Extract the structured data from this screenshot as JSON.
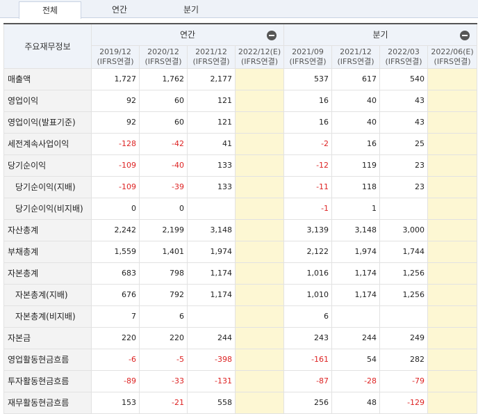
{
  "tabs": [
    "전체",
    "연간",
    "분기"
  ],
  "header": {
    "label": "주요재무정보",
    "group_annual": "연간",
    "group_quarter": "분기",
    "periods": [
      {
        "date": "2019/12",
        "basis": "(IFRS연결)"
      },
      {
        "date": "2020/12",
        "basis": "(IFRS연결)"
      },
      {
        "date": "2021/12",
        "basis": "(IFRS연결)"
      },
      {
        "date": "2022/12(E)",
        "basis": "(IFRS연결)"
      },
      {
        "date": "2021/09",
        "basis": "(IFRS연결)"
      },
      {
        "date": "2021/12",
        "basis": "(IFRS연결)"
      },
      {
        "date": "2022/03",
        "basis": "(IFRS연결)"
      },
      {
        "date": "2022/06(E)",
        "basis": "(IFRS연결)"
      }
    ]
  },
  "rows": [
    {
      "label": "매출액",
      "indent": false,
      "values": [
        "1,727",
        "1,762",
        "2,177",
        "",
        "537",
        "617",
        "540",
        ""
      ]
    },
    {
      "label": "영업이익",
      "indent": false,
      "values": [
        "92",
        "60",
        "121",
        "",
        "16",
        "40",
        "43",
        ""
      ]
    },
    {
      "label": "영업이익(발표기준)",
      "indent": false,
      "values": [
        "92",
        "60",
        "121",
        "",
        "16",
        "40",
        "43",
        ""
      ]
    },
    {
      "label": "세전계속사업이익",
      "indent": false,
      "values": [
        "-128",
        "-42",
        "41",
        "",
        "-2",
        "16",
        "25",
        ""
      ]
    },
    {
      "label": "당기순이익",
      "indent": false,
      "values": [
        "-109",
        "-40",
        "133",
        "",
        "-12",
        "119",
        "23",
        ""
      ]
    },
    {
      "label": "당기순이익(지배)",
      "indent": true,
      "values": [
        "-109",
        "-39",
        "133",
        "",
        "-11",
        "118",
        "23",
        ""
      ]
    },
    {
      "label": "당기순이익(비지배)",
      "indent": true,
      "values": [
        "0",
        "0",
        "",
        "",
        "-1",
        "1",
        "",
        ""
      ]
    },
    {
      "label": "자산총계",
      "indent": false,
      "values": [
        "2,242",
        "2,199",
        "3,148",
        "",
        "3,139",
        "3,148",
        "3,000",
        ""
      ]
    },
    {
      "label": "부채총계",
      "indent": false,
      "values": [
        "1,559",
        "1,401",
        "1,974",
        "",
        "2,122",
        "1,974",
        "1,744",
        ""
      ]
    },
    {
      "label": "자본총계",
      "indent": false,
      "values": [
        "683",
        "798",
        "1,174",
        "",
        "1,016",
        "1,174",
        "1,256",
        ""
      ]
    },
    {
      "label": "자본총계(지배)",
      "indent": true,
      "values": [
        "676",
        "792",
        "1,174",
        "",
        "1,010",
        "1,174",
        "1,256",
        ""
      ]
    },
    {
      "label": "자본총계(비지배)",
      "indent": true,
      "values": [
        "7",
        "6",
        "",
        "",
        "6",
        "",
        "",
        ""
      ]
    },
    {
      "label": "자본금",
      "indent": false,
      "values": [
        "220",
        "220",
        "244",
        "",
        "243",
        "244",
        "249",
        ""
      ]
    },
    {
      "label": "영업활동현금흐름",
      "indent": false,
      "values": [
        "-6",
        "-5",
        "-398",
        "",
        "-161",
        "54",
        "282",
        ""
      ]
    },
    {
      "label": "투자활동현금흐름",
      "indent": false,
      "values": [
        "-89",
        "-33",
        "-131",
        "",
        "-87",
        "-28",
        "-79",
        ""
      ]
    },
    {
      "label": "재무활동현금흐름",
      "indent": false,
      "values": [
        "153",
        "-21",
        "558",
        "",
        "256",
        "48",
        "-129",
        ""
      ]
    }
  ],
  "estimate_columns": [
    3,
    7
  ],
  "colors": {
    "negative": "#d22222",
    "estimate_bg": "#fdf7d3",
    "header_bg": "#eff3f9",
    "label_bg": "#f3f3f3"
  }
}
